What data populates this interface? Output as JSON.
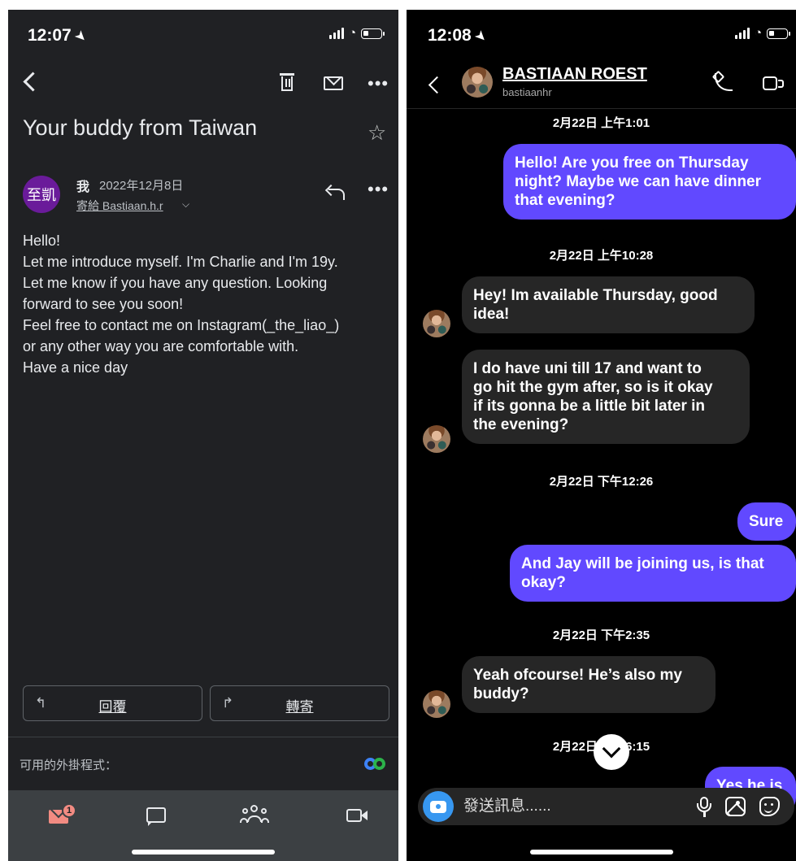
{
  "mail_screen": {
    "status_time": "12:07",
    "subject": "Your buddy from Taiwan",
    "sender_avatar_text": "至凱",
    "sender_name": "我",
    "sent_date": "2022年12月8日",
    "recipient": "寄給 Bastiaan.h.r",
    "body_lines": [
      "Hello!",
      "Let me introduce myself. I'm Charlie and I'm 19y.",
      "Let me know if you have any question. Looking",
      "forward to see you soon!",
      "Feel free to contact me on Instagram(_the_liao_)",
      "or any other way you are comfortable with.",
      "Have a nice day"
    ],
    "reply_button_label": "回覆",
    "forward_button_label": "轉寄",
    "addons_label": "可用的外掛程式：",
    "mail_badge_count": "1",
    "icons": [
      "back-icon",
      "trash-icon",
      "envelope-icon",
      "more-icon",
      "star-icon",
      "reply-icon",
      "reply-arrow-icon",
      "forward-arrow-icon",
      "webex-addon-icon",
      "mail-nav-icon",
      "chat-nav-icon",
      "spaces-nav-icon",
      "meet-nav-icon"
    ],
    "colors": {
      "background": "#202124",
      "avatar": "#6a1b9a",
      "badge": "#f28b82"
    }
  },
  "chat_screen": {
    "status_time": "12:08",
    "contact_name": "BASTIAAN ROEST",
    "contact_handle": "bastiaanhr",
    "timestamps": [
      "2月22日 上午1:01",
      "2月22日 上午10:28",
      "2月22日 下午12:26",
      "2月22日 下午2:35",
      "2月22日 下午6:15"
    ],
    "messages": [
      {
        "direction": "out",
        "lines": [
          "Hello! Are you free on Thursday",
          "night? Maybe we can have dinner",
          "that evening?"
        ]
      },
      {
        "direction": "in",
        "lines": [
          "Hey! Im available Thursday, good",
          "idea!"
        ]
      },
      {
        "direction": "in",
        "lines": [
          "I do have uni till 17 and want to",
          "go hit the gym after, so is it okay",
          "if its gonna be a little bit later in",
          "the evening?"
        ]
      },
      {
        "direction": "out",
        "lines": [
          "Sure"
        ]
      },
      {
        "direction": "out",
        "lines": [
          "And Jay will be joining us, is that",
          "okay?"
        ]
      },
      {
        "direction": "in",
        "lines": [
          "Yeah ofcourse! He’s also my",
          "buddy?"
        ]
      },
      {
        "direction": "out",
        "lines": [
          "Yes he is"
        ]
      }
    ],
    "composer_placeholder": "發送訊息......",
    "icons": [
      "back-icon",
      "phone-icon",
      "video-icon",
      "scroll-down-icon",
      "camera-icon",
      "mic-icon",
      "gallery-icon",
      "sticker-icon"
    ],
    "colors": {
      "background": "#000000",
      "outgoing_bubble": "#6149ff",
      "incoming_bubble": "#262626",
      "camera_button": "#3797f0"
    }
  }
}
